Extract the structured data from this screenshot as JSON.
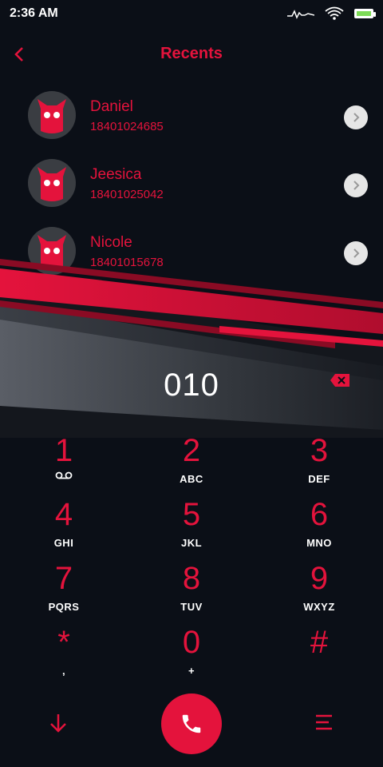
{
  "status_bar": {
    "time": "2:36 AM",
    "icons": [
      "activity-icon",
      "wifi-icon",
      "battery-icon"
    ]
  },
  "header": {
    "title": "Recents",
    "back_icon": "chevron-left-icon"
  },
  "recents": [
    {
      "name": "Daniel",
      "number": "18401024685"
    },
    {
      "name": "Jeesica",
      "number": "18401025042"
    },
    {
      "name": "Nicole",
      "number": "18401015678"
    }
  ],
  "dialer": {
    "number": "010",
    "backspace_icon": "backspace-icon"
  },
  "keypad": [
    {
      "digit": "1",
      "letters": "",
      "icon": "voicemail-icon"
    },
    {
      "digit": "2",
      "letters": "ABC"
    },
    {
      "digit": "3",
      "letters": "DEF"
    },
    {
      "digit": "4",
      "letters": "GHI"
    },
    {
      "digit": "5",
      "letters": "JKL"
    },
    {
      "digit": "6",
      "letters": "MNO"
    },
    {
      "digit": "7",
      "letters": "PQRS"
    },
    {
      "digit": "8",
      "letters": "TUV"
    },
    {
      "digit": "9",
      "letters": "WXYZ"
    },
    {
      "digit": "*",
      "letters": ","
    },
    {
      "digit": "0",
      "letters": "+"
    },
    {
      "digit": "#",
      "letters": ""
    }
  ],
  "bottom_bar": {
    "icons": [
      "arrow-down-icon",
      "phone-icon",
      "menu-icon"
    ]
  },
  "colors": {
    "accent": "#e4133c",
    "background": "#0b0f17",
    "avatar_bg": "#3a3d42"
  }
}
